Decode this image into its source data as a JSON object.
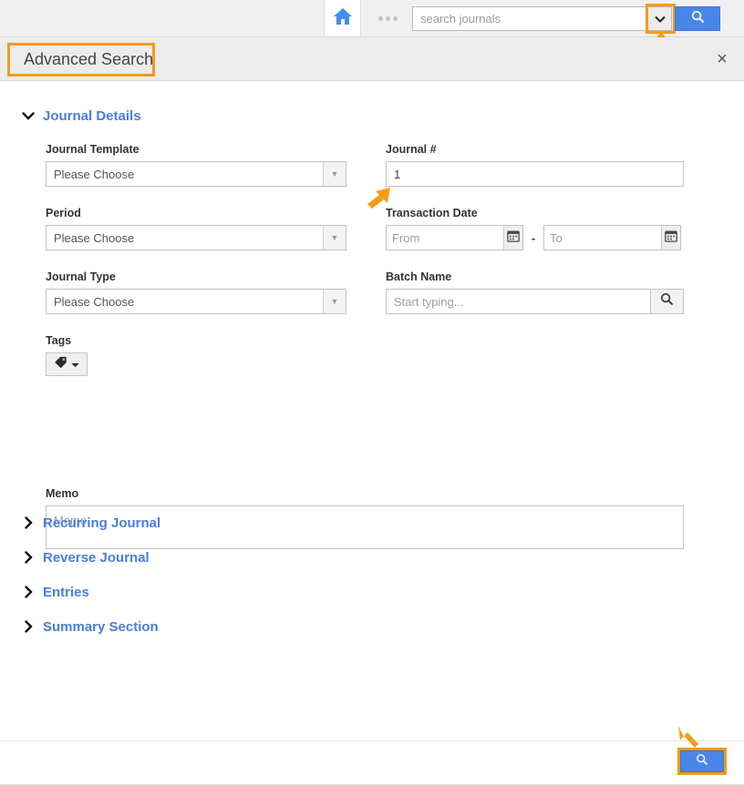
{
  "topbar": {
    "home_icon": "home-icon",
    "ellipsis_icon": "ellipsis-icon",
    "search_placeholder": "search journals",
    "search_value": "",
    "dropdown_icon": "chevron-down-icon",
    "search_button_icon": "search-icon"
  },
  "header": {
    "title": "Advanced Search",
    "close_icon": "×"
  },
  "sections": {
    "journal_details": {
      "label": "Journal Details",
      "expanded": true,
      "chevron": "❯"
    },
    "collapsed": [
      {
        "label": "Recurring Journal",
        "chevron": "❯"
      },
      {
        "label": "Reverse Journal",
        "chevron": "❯"
      },
      {
        "label": "Entries",
        "chevron": "❯"
      },
      {
        "label": "Summary Section",
        "chevron": "❯"
      }
    ]
  },
  "fields": {
    "journal_template": {
      "label": "Journal Template",
      "value": "Please Choose",
      "arrow_icon": "caret-down-icon"
    },
    "period": {
      "label": "Period",
      "value": "Please Choose",
      "arrow_icon": "caret-down-icon"
    },
    "journal_type": {
      "label": "Journal Type",
      "value": "Please Choose",
      "arrow_icon": "caret-down-icon"
    },
    "journal_number": {
      "label": "Journal #",
      "value": "1",
      "placeholder": ""
    },
    "transaction_date": {
      "label": "Transaction Date",
      "from_placeholder": "From",
      "from_value": "",
      "to_placeholder": "To",
      "to_value": "",
      "separator": "-",
      "calendar_icon": "calendar-icon"
    },
    "batch_name": {
      "label": "Batch Name",
      "placeholder": "Start typing...",
      "value": "",
      "search_icon": "search-icon"
    },
    "tags": {
      "label": "Tags",
      "tag_icon": "tag-icon",
      "caret_icon": "caret-down-icon"
    },
    "memo": {
      "label": "Memo",
      "placeholder": "Memo",
      "value": ""
    }
  },
  "footer": {
    "search_button_icon": "search-icon"
  },
  "colors": {
    "accent_blue": "#4a86e8",
    "link_blue": "#4a7ddc",
    "highlight_orange": "#f59b16",
    "header_gray": "#ececec"
  }
}
